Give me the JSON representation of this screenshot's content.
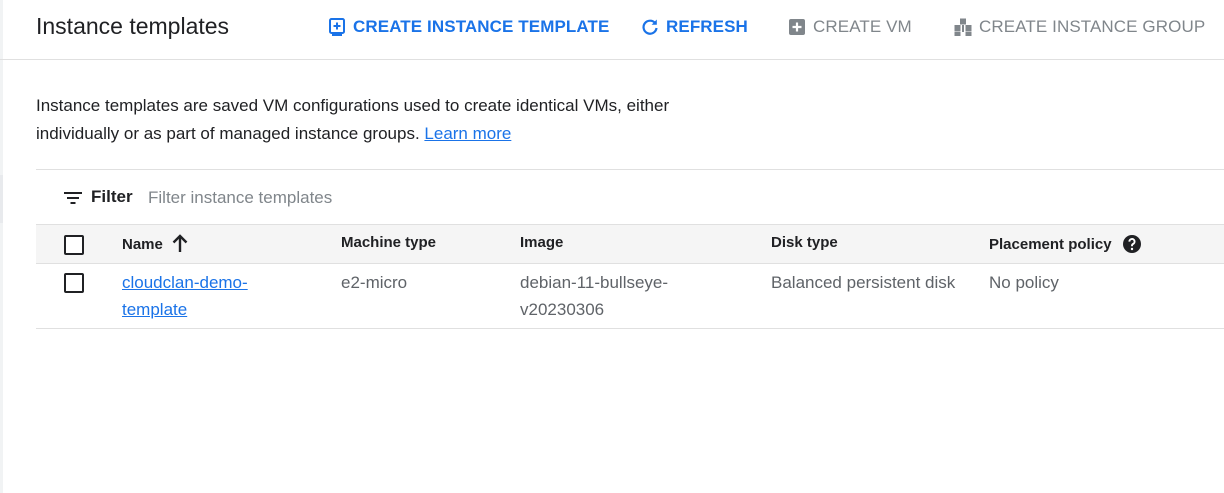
{
  "header": {
    "title": "Instance templates",
    "actions": {
      "create_instance_template": "CREATE INSTANCE TEMPLATE",
      "refresh": "REFRESH",
      "create_vm": "CREATE VM",
      "create_instance_group": "CREATE INSTANCE GROUP"
    }
  },
  "description": {
    "text": "Instance templates are saved VM configurations used to create identical VMs, either individually or as part of managed instance groups.",
    "link": "Learn more"
  },
  "filter": {
    "label": "Filter",
    "placeholder": "Filter instance templates",
    "value": ""
  },
  "table": {
    "columns": {
      "name": "Name",
      "machine_type": "Machine type",
      "image": "Image",
      "disk_type": "Disk type",
      "placement_policy": "Placement policy"
    },
    "sort": {
      "column": "name",
      "direction": "ascending"
    },
    "rows": [
      {
        "checked": false,
        "name": "cloudclan-demo-template",
        "machine_type": "e2-micro",
        "image": "debian-11-bullseye-v20230306",
        "disk_type": "Balanced persistent disk",
        "placement_policy": "No policy"
      }
    ]
  },
  "colors": {
    "accent": "#1a73e8",
    "disabled": "#80868b",
    "text": "#202124",
    "secondary_text": "#5f6368",
    "header_bg": "#f5f5f5",
    "divider": "#e0e0e0"
  },
  "icons": {
    "create_instance_template": "add-box-icon",
    "refresh": "refresh-icon",
    "create_vm": "add-box-icon",
    "create_instance_group": "instance-group-icon",
    "filter": "filter-list-icon",
    "sort": "arrow-upward-icon",
    "help": "help-icon"
  }
}
